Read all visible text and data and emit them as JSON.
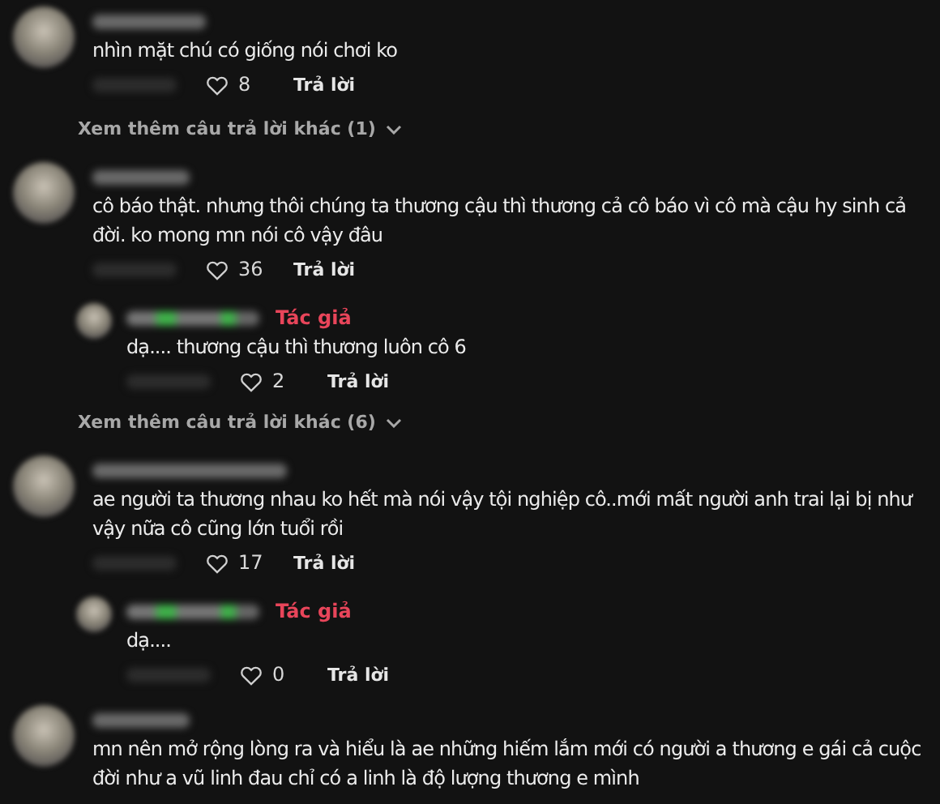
{
  "thread": [
    {
      "kind": "comment",
      "text": "nhìn mặt chú có giống nói chơi ko",
      "likes": "8",
      "reply_label": "Trả lời"
    },
    {
      "kind": "more",
      "text": "Xem thêm câu trả lời khác (1)"
    },
    {
      "kind": "comment",
      "text": "cô báo thật. nhưng thôi chúng ta thương cậu thì thương cả cô báo vì cô mà cậu hy sinh cả đời. ko mong mn nói cô vậy đâu",
      "likes": "36",
      "reply_label": "Trả lời"
    },
    {
      "kind": "reply",
      "badge": "Tác giả",
      "text": "dạ.... thương cậu thì thương luôn cô 6",
      "likes": "2",
      "reply_label": "Trả lời"
    },
    {
      "kind": "more",
      "text": "Xem thêm câu trả lời khác (6)"
    },
    {
      "kind": "comment",
      "text": "ae người ta thương nhau ko hết mà nói vậy tội nghiệp cô..mới mất người anh trai lại bị như vậy nữa cô cũng lớn tuổi rồi",
      "likes": "17",
      "reply_label": "Trả lời"
    },
    {
      "kind": "reply",
      "badge": "Tác giả",
      "text": "dạ....",
      "likes": "0",
      "reply_label": "Trả lời"
    },
    {
      "kind": "comment",
      "text": "mn nên mở rộng lòng ra và hiểu là ae những hiếm lắm mới có người a thương e gái cả cuộc đời như a vũ linh đau chỉ có a linh là độ lượng thương e mình"
    }
  ]
}
